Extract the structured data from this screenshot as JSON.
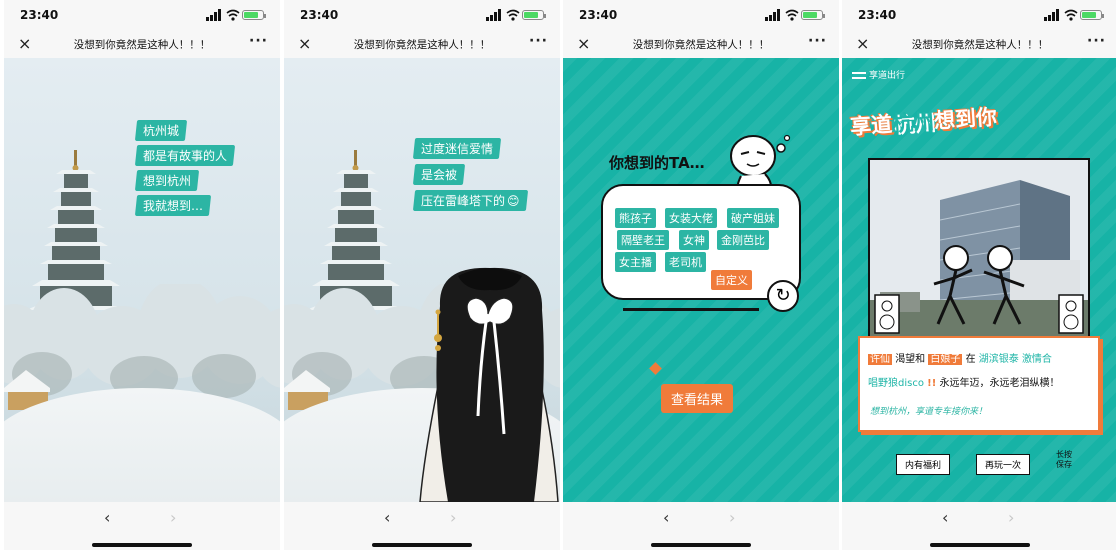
{
  "status": {
    "time": "23:40"
  },
  "navbar": {
    "title": "没想到你竟然是这种人！！！",
    "close_icon": "×",
    "more_icon": "···"
  },
  "bottom": {
    "back_icon": "‹",
    "forward_icon": "›"
  },
  "screen1": {
    "lines": [
      "杭州城",
      "都是有故事的人",
      "想到杭州",
      "我就想到…"
    ]
  },
  "screen2": {
    "lines": [
      "过度迷信爱情",
      "是会被",
      "压在雷峰塔下的"
    ],
    "emoji": "😊"
  },
  "screen3": {
    "prompt": "你想到的TA…",
    "tags": [
      "熊孩子",
      "女装大佬",
      "破产姐妹",
      "隔壁老王",
      "女神",
      "金刚芭比",
      "女主播",
      "老司机"
    ],
    "custom_tag": "自定义",
    "refresh_icon": "↻",
    "result_button": "查看结果"
  },
  "screen4": {
    "brand": "享道出行",
    "headline_a": "享道",
    "headline_b": "杭州",
    "headline_c": "想到你",
    "desc_line1": [
      "许仙",
      "渴望和",
      "白娘子",
      "在",
      "湖滨银泰",
      "激情合"
    ],
    "desc_line2": [
      "唱野狼disco",
      "!!",
      "永远年迈，永远老泪纵横！"
    ],
    "signature": "想到杭州，享道专车接你来！",
    "welfare_button": "内有福利",
    "replay_button": "再玩一次",
    "save_hint": [
      "长按",
      "保存"
    ]
  },
  "colors": {
    "teal": "#17b3a6",
    "caption": "#2cb5a4",
    "orange": "#f07b3a"
  }
}
